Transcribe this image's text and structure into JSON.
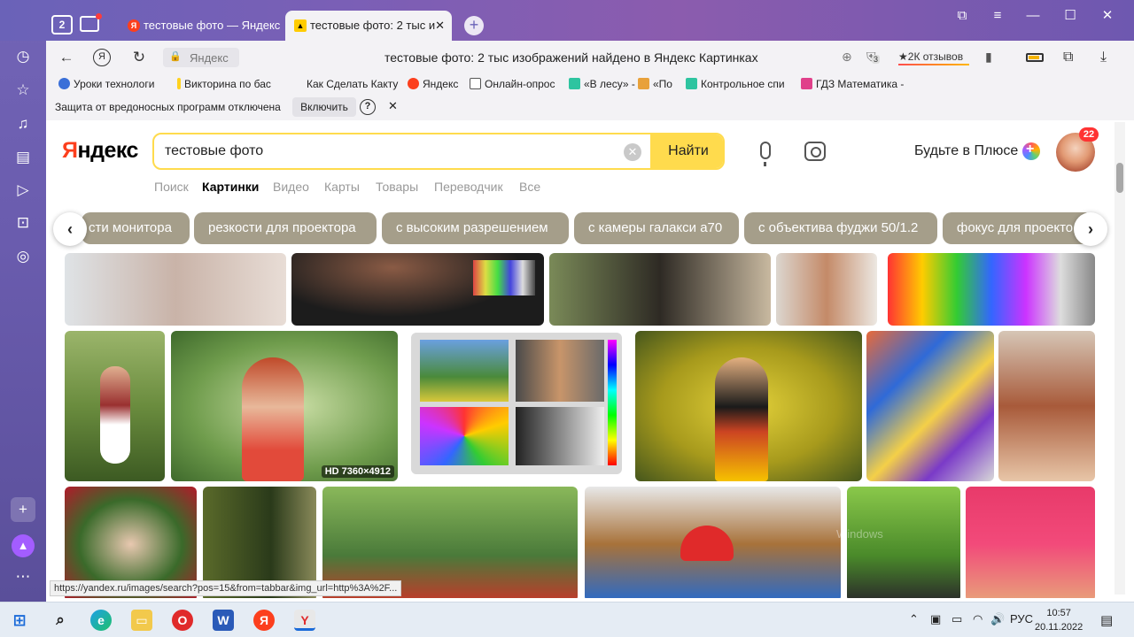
{
  "tabs": {
    "counter": "2",
    "inactive_title": "тестовые фото — Яндекс",
    "active_title": "тестовые фото: 2 тыс и"
  },
  "address": {
    "domain": "Яндекс",
    "title": "тестовые фото: 2 тыс изображений найдено в Яндекс Картинках",
    "badge_num": "3",
    "reviews": "2К отзывов"
  },
  "bookmarks": [
    "Уроки технологи",
    "Викторина по бас",
    "Как Сделать Какту",
    "Яндекс",
    "Онлайн-опрос",
    "«В лесу» -",
    "«По",
    "Контрольное спи",
    "ГДЗ Математика -"
  ],
  "protection": {
    "text": "Защита от вредоносных программ отключена",
    "button": "Включить",
    "help": "?"
  },
  "yandex": {
    "logo_red": "Я",
    "logo_rest": "ндекс",
    "query": "тестовые фото",
    "search_button": "Найти",
    "plus_text": "Будьте в Плюсе",
    "notif_count": "22"
  },
  "nav_tabs": [
    "Поиск",
    "Картинки",
    "Видео",
    "Карты",
    "Товары",
    "Переводчик",
    "Все"
  ],
  "chips": [
    "сти монитора",
    "резкости для проектора",
    "с высоким разрешением",
    "с камеры галакси а70",
    "с объектива фуджи 50/1.2",
    "фокус для проекто"
  ],
  "image_badge": "HD 7360×4912",
  "status_url": "https://yandex.ru/images/search?pos=15&from=tabbar&img_url=http%3A%2F...",
  "watermark": "Windows",
  "taskbar": {
    "lang": "РУС",
    "time": "10:57",
    "date": "20.11.2022"
  }
}
